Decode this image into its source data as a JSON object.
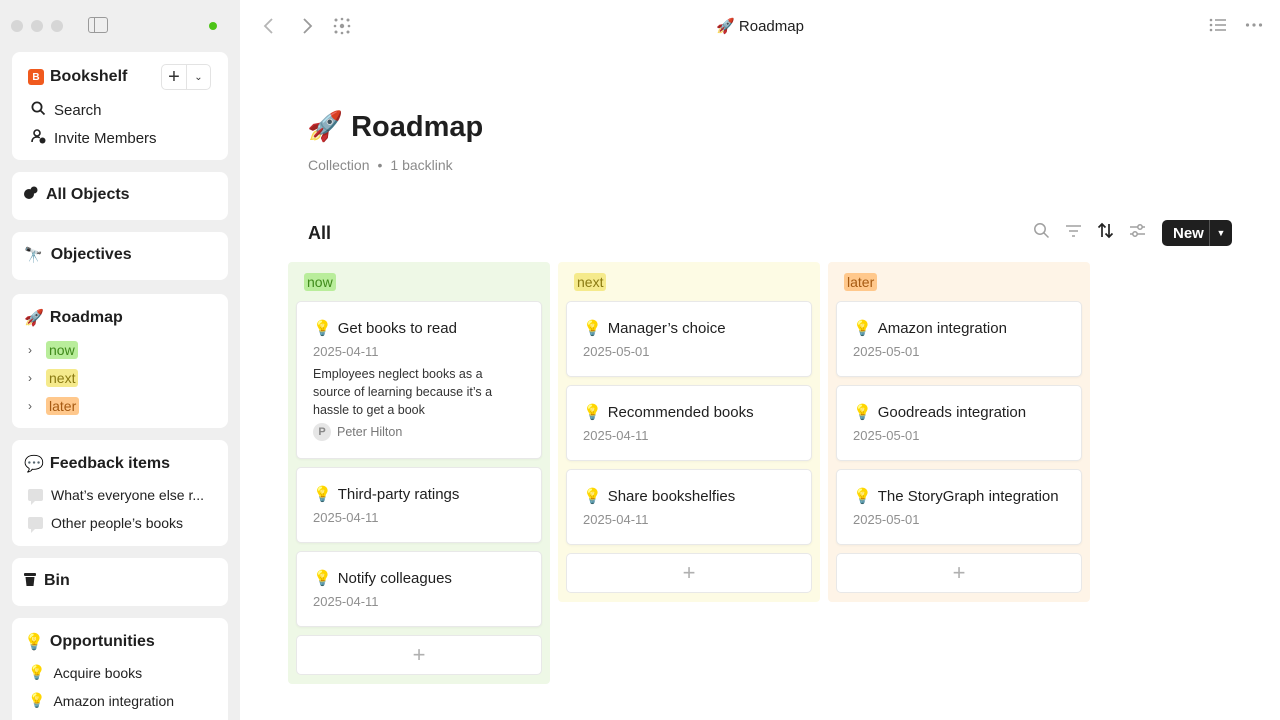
{
  "window": {
    "title_icon": "🚀",
    "title": "Roadmap"
  },
  "sidebar": {
    "workspace": {
      "logo_letter": "B",
      "name": "Bookshelf",
      "search_label": "Search",
      "invite_label": "Invite Members"
    },
    "all_objects": {
      "icon": "⬤",
      "label": "All Objects"
    },
    "objectives": {
      "icon": "🔭",
      "label": "Objectives"
    },
    "roadmap": {
      "icon": "🚀",
      "label": "Roadmap",
      "items": [
        {
          "label": "now"
        },
        {
          "label": "next"
        },
        {
          "label": "later"
        }
      ]
    },
    "feedback": {
      "icon": "💬",
      "label": "Feedback items",
      "items": [
        {
          "label": "What’s everyone else r..."
        },
        {
          "label": "Other people’s books"
        }
      ]
    },
    "bin": {
      "label": "Bin"
    },
    "opportunities": {
      "icon": "💡",
      "label": "Opportunities",
      "items": [
        {
          "icon": "💡",
          "label": "Acquire books"
        },
        {
          "icon": "💡",
          "label": "Amazon integration"
        }
      ]
    }
  },
  "page": {
    "icon": "🚀",
    "title": "Roadmap",
    "meta_type": "Collection",
    "meta_separator": "•",
    "meta_backlinks": "1 backlink",
    "view_label": "All",
    "new_button": "New"
  },
  "board": {
    "columns": [
      {
        "tag": "now",
        "cards": [
          {
            "icon": "💡",
            "title": "Get books to read",
            "date": "2025-04-11",
            "description": "Employees neglect books as a source of learning because it’s a hassle to get a book",
            "owner_initial": "P",
            "owner": "Peter Hilton"
          },
          {
            "icon": "💡",
            "title": "Third-party ratings",
            "date": "2025-04-11"
          },
          {
            "icon": "💡",
            "title": "Notify colleagues",
            "date": "2025-04-11"
          }
        ]
      },
      {
        "tag": "next",
        "cards": [
          {
            "icon": "💡",
            "title": "Manager’s choice",
            "date": "2025-05-01"
          },
          {
            "icon": "💡",
            "title": "Recommended books",
            "date": "2025-04-11"
          },
          {
            "icon": "💡",
            "title": "Share bookshelfies",
            "date": "2025-04-11"
          }
        ]
      },
      {
        "tag": "later",
        "cards": [
          {
            "icon": "💡",
            "title": "Amazon integration",
            "date": "2025-05-01"
          },
          {
            "icon": "💡",
            "title": "Goodreads integration",
            "date": "2025-05-01"
          },
          {
            "icon": "💡",
            "title": "The StoryGraph integration",
            "date": "2025-05-01"
          }
        ]
      }
    ],
    "add_symbol": "+"
  },
  "colors": {
    "now": "#b9ed9b",
    "next": "#f5ea8c",
    "later": "#ffc88c",
    "online": "#4cc417",
    "workspace_logo": "#f05a1e"
  }
}
